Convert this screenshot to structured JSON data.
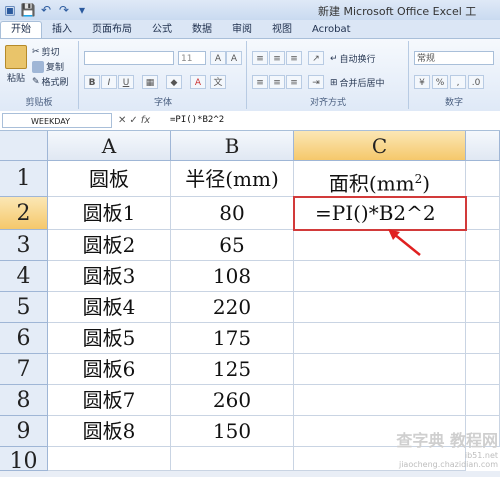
{
  "titlebar": {
    "title": "新建 Microsoft Office Excel 工",
    "qat_icons": [
      "excel-logo-icon",
      "save-icon",
      "undo-icon",
      "redo-icon",
      "customize-icon"
    ]
  },
  "tabs": [
    {
      "label": "开始",
      "active": true
    },
    {
      "label": "插入",
      "active": false
    },
    {
      "label": "页面布局",
      "active": false
    },
    {
      "label": "公式",
      "active": false
    },
    {
      "label": "数据",
      "active": false
    },
    {
      "label": "审阅",
      "active": false
    },
    {
      "label": "视图",
      "active": false
    },
    {
      "label": "Acrobat",
      "active": false
    }
  ],
  "ribbon": {
    "clipboard": {
      "paste": "粘贴",
      "cut": "剪切",
      "copy": "复制",
      "format_painter": "格式刷",
      "label": "剪贴板"
    },
    "font": {
      "size": "11",
      "label": "字体",
      "bold": "B",
      "italic": "I",
      "underline": "U"
    },
    "alignment": {
      "wrap": "自动换行",
      "merge": "合并后居中",
      "label": "对齐方式"
    },
    "number": {
      "format": "常规",
      "label": "数字",
      "percent": "%",
      "comma": ","
    }
  },
  "formula_bar": {
    "name_box": "WEEKDAY",
    "cancel": "✕",
    "enter": "✓",
    "fx": "fx",
    "content": "=PI()*B2^2"
  },
  "sheet": {
    "columns": [
      "A",
      "B",
      "C"
    ],
    "selected_column": "C",
    "rows": [
      "1",
      "2",
      "3",
      "4",
      "5",
      "6",
      "7",
      "8",
      "9",
      "10"
    ],
    "selected_row": "2",
    "header_a": "圆板",
    "header_b": "半径(mm)",
    "header_c_base": "面积(mm",
    "header_c_sup": "2",
    "header_c_end": ")",
    "data": [
      {
        "a": "圆板1",
        "b": "80"
      },
      {
        "a": "圆板2",
        "b": "65"
      },
      {
        "a": "圆板3",
        "b": "108"
      },
      {
        "a": "圆板4",
        "b": "220"
      },
      {
        "a": "圆板5",
        "b": "175"
      },
      {
        "a": "圆板6",
        "b": "125"
      },
      {
        "a": "圆板7",
        "b": "260"
      },
      {
        "a": "圆板8",
        "b": "150"
      }
    ],
    "editing_cell_value": "=PI()*B2^2"
  },
  "watermark": {
    "line1": "查字典 教程网",
    "line2": "ib51.net",
    "line3": "jiaocheng.chazidian.com"
  },
  "colors": {
    "accent": "#d23a3a",
    "selected_header": "#f5c86b"
  }
}
